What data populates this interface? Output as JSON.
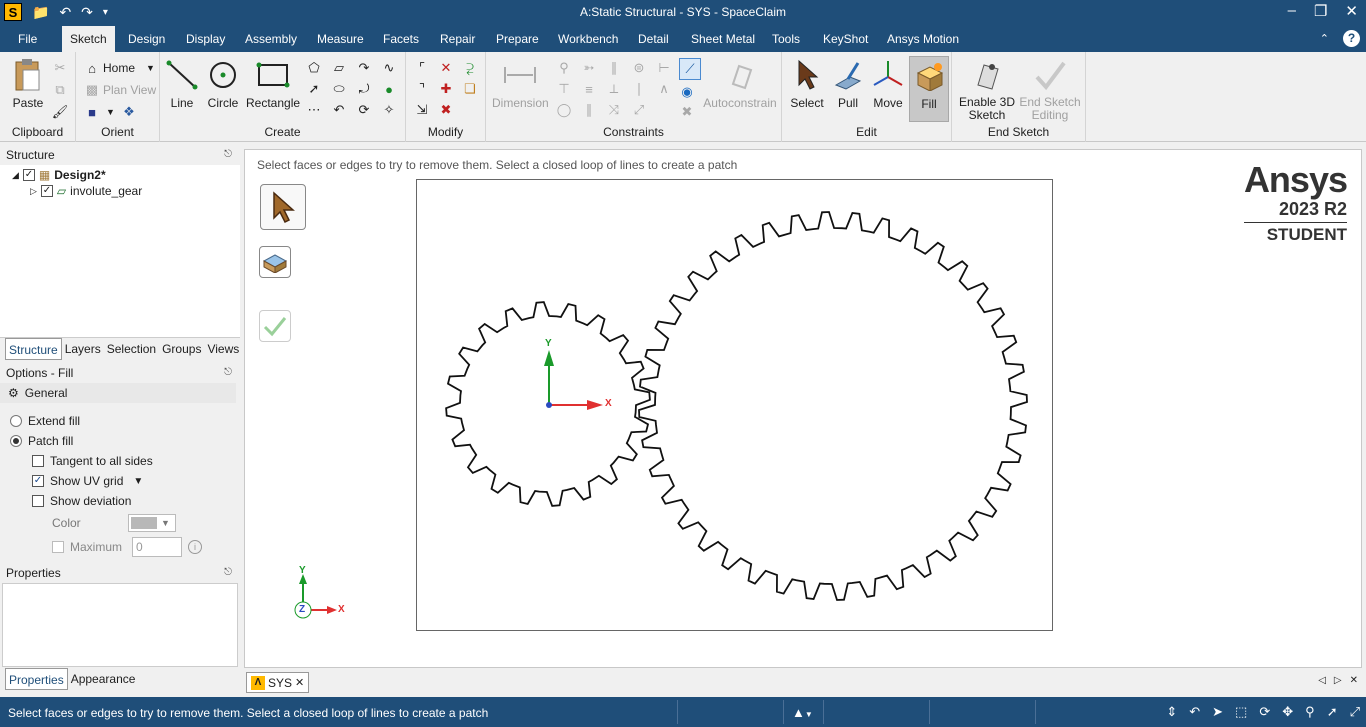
{
  "window": {
    "title": "A:Static Structural - SYS - SpaceClaim"
  },
  "menu": {
    "tabs": [
      "File",
      "Sketch",
      "Design",
      "Display",
      "Assembly",
      "Measure",
      "Facets",
      "Repair",
      "Prepare",
      "Workbench",
      "Detail",
      "Sheet Metal",
      "Tools",
      "KeyShot",
      "Ansys Motion"
    ],
    "active": "Sketch"
  },
  "ribbon": {
    "clipboard": {
      "label": "Clipboard",
      "paste": "Paste"
    },
    "orient": {
      "label": "Orient",
      "home": "Home",
      "plan_view": "Plan View"
    },
    "create": {
      "label": "Create",
      "line": "Line",
      "circle": "Circle",
      "rectangle": "Rectangle"
    },
    "modify": {
      "label": "Modify"
    },
    "constraints": {
      "label": "Constraints",
      "dimension": "Dimension",
      "autoconstrain": "Autoconstrain"
    },
    "edit": {
      "label": "Edit",
      "select": "Select",
      "pull": "Pull",
      "move": "Move",
      "fill": "Fill"
    },
    "end_sketch": {
      "label": "End Sketch",
      "enable3d": [
        "Enable 3D",
        "Sketch"
      ],
      "end_editing": [
        "End Sketch",
        "Editing"
      ]
    }
  },
  "structure": {
    "title": "Structure",
    "root": "Design2*",
    "child": "involute_gear",
    "tabs": [
      "Structure",
      "Layers",
      "Selection",
      "Groups",
      "Views"
    ]
  },
  "options": {
    "title": "Options - Fill",
    "section": "General",
    "extend_fill": "Extend fill",
    "patch_fill": "Patch fill",
    "tangent": "Tangent to all sides",
    "show_uv": "Show UV grid",
    "show_dev": "Show deviation",
    "color": "Color",
    "maximum": "Maximum",
    "max_value": "0"
  },
  "properties": {
    "title": "Properties",
    "tabs": [
      "Properties",
      "Appearance"
    ]
  },
  "canvas": {
    "hint": "Select faces or edges to try to remove them. Select a closed loop of lines to create a patch",
    "axis_x": "X",
    "axis_y": "Y",
    "axis_z": "Z",
    "brand": {
      "name": "Ansys",
      "version": "2023 R2",
      "edition": "STUDENT"
    }
  },
  "doc_tab": "SYS",
  "status": {
    "message": "Select faces or edges to try to remove them. Select a closed loop of lines to create a patch"
  }
}
